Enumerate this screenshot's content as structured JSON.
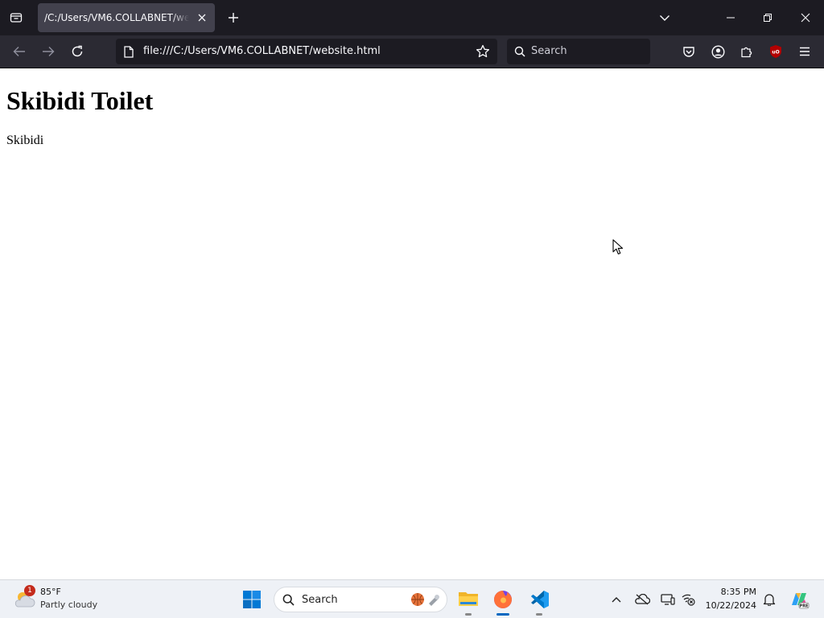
{
  "browser": {
    "tab_title": "/C:/Users/VM6.COLLABNET/website.html",
    "url": "file:///C:/Users/VM6.COLLABNET/website.html",
    "search_placeholder": "Search"
  },
  "page": {
    "heading": "Skibidi Toilet",
    "paragraph": "Skibidi"
  },
  "taskbar": {
    "weather_temp": "85°F",
    "weather_desc": "Partly cloudy",
    "weather_badge": "1",
    "search_label": "Search",
    "clock_time": "8:35 PM",
    "clock_date": "10/22/2024"
  },
  "colors": {
    "titlebar_bg": "#1c1b22",
    "navbar_bg": "#2b2a33",
    "active_tab": "#42414d",
    "ublock_red": "#b30000",
    "windows_blue": "#0078d4",
    "taskbar_bg": "#eef1f6"
  },
  "icons": {
    "tab_list": "tab-list-icon",
    "new_tab": "plus-icon",
    "list_all_tabs": "chevron-down-icon",
    "minimize": "minimize-icon",
    "restore": "restore-icon",
    "close": "close-icon",
    "back": "back-arrow-icon",
    "forward": "forward-arrow-icon",
    "reload": "reload-icon",
    "page_info": "page-icon",
    "bookmark": "star-icon",
    "pocket": "pocket-icon",
    "account": "account-icon",
    "extensions": "puzzle-icon",
    "ublock": "ublock-icon",
    "menu": "hamburger-icon"
  }
}
